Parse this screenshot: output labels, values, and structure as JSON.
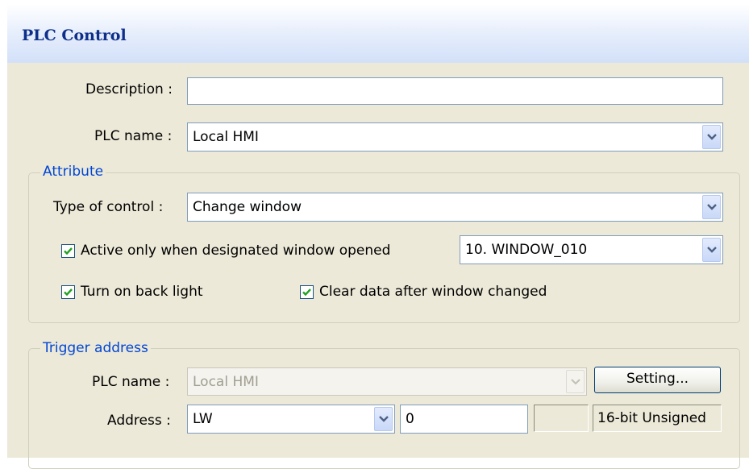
{
  "window": {
    "title": "PLC Control"
  },
  "general": {
    "description_label": "Description :",
    "description_value": "",
    "plc_name_label": "PLC name :",
    "plc_name_value": "Local HMI"
  },
  "attribute": {
    "legend": "Attribute",
    "type_label": "Type of control :",
    "type_value": "Change window",
    "active_only_label": "Active only when designated window opened",
    "active_only_checked": true,
    "window_value": "10. WINDOW_010",
    "backlight_label": "Turn on back light",
    "backlight_checked": true,
    "clear_data_label": "Clear data after window changed",
    "clear_data_checked": true
  },
  "trigger": {
    "legend": "Trigger address",
    "plc_name_label": "PLC name :",
    "plc_name_value": "Local HMI",
    "setting_button": "Setting...",
    "address_label": "Address :",
    "device_type": "LW",
    "address_value": "0",
    "format_value": "16-bit Unsigned"
  },
  "icons": {
    "dropdown": "chevron-down-icon",
    "checkbox": "checkmark-icon"
  },
  "colors": {
    "accent": "#0046d5",
    "title_text": "#0d2f8a",
    "checkmark": "#21a121",
    "window_bg": "#ece9d8"
  }
}
